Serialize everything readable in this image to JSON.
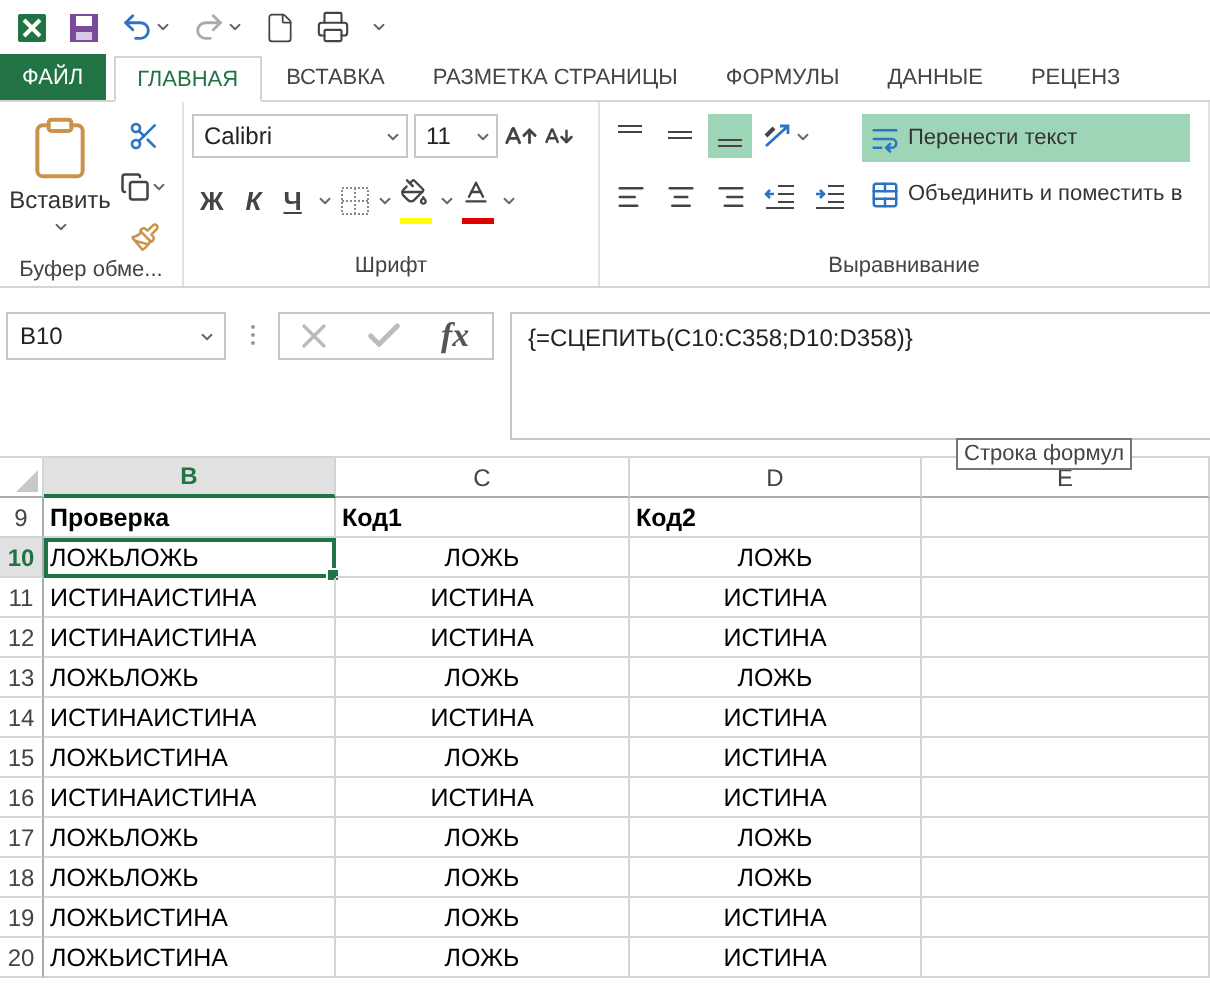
{
  "tabs": [
    {
      "label": "ФАЙЛ",
      "kind": "file",
      "selected": false
    },
    {
      "label": "ГЛАВНАЯ",
      "kind": "normal",
      "selected": true
    },
    {
      "label": "ВСТАВКА",
      "kind": "normal",
      "selected": false
    },
    {
      "label": "РАЗМЕТКА СТРАНИЦЫ",
      "kind": "normal",
      "selected": false
    },
    {
      "label": "ФОРМУЛЫ",
      "kind": "normal",
      "selected": false
    },
    {
      "label": "ДАННЫЕ",
      "kind": "normal",
      "selected": false
    },
    {
      "label": "РЕЦЕНЗ",
      "kind": "normal",
      "selected": false
    }
  ],
  "ribbon": {
    "clipboard": {
      "paste_label": "Вставить",
      "group_label": "Буфер обме..."
    },
    "font": {
      "font_name": "Calibri",
      "font_size": "11",
      "bold": "Ж",
      "italic": "К",
      "underline": "Ч",
      "group_label": "Шрифт"
    },
    "alignment": {
      "vertical": [
        {
          "selected": false
        },
        {
          "selected": false
        },
        {
          "selected": true
        }
      ],
      "wrap_text": {
        "label": "Перенести текст",
        "selected": true
      },
      "merge": {
        "label": "Объединить и поместить в"
      },
      "group_label": "Выравнивание"
    }
  },
  "formula_bar": {
    "name_box": "B10",
    "insert_function": "fx",
    "formula": "{=СЦЕПИТЬ(C10:C358;D10:D358)}",
    "tooltip": "Строка формул"
  },
  "sheet": {
    "columns": [
      {
        "label": "B",
        "selected": true
      },
      {
        "label": "C",
        "selected": false
      },
      {
        "label": "D",
        "selected": false
      },
      {
        "label": "E",
        "selected": false
      }
    ],
    "rows": [
      {
        "number": "9",
        "kind": "header",
        "selected": false,
        "cells": [
          "Проверка",
          "Код1",
          "Код2"
        ]
      },
      {
        "number": "10",
        "kind": "data",
        "selected": true,
        "cells": [
          "ЛОЖЬЛОЖЬ",
          "ЛОЖЬ",
          "ЛОЖЬ"
        ]
      },
      {
        "number": "11",
        "kind": "data",
        "selected": false,
        "cells": [
          "ИСТИНАИСТИНА",
          "ИСТИНА",
          "ИСТИНА"
        ]
      },
      {
        "number": "12",
        "kind": "data",
        "selected": false,
        "cells": [
          "ИСТИНАИСТИНА",
          "ИСТИНА",
          "ИСТИНА"
        ]
      },
      {
        "number": "13",
        "kind": "data",
        "selected": false,
        "cells": [
          "ЛОЖЬЛОЖЬ",
          "ЛОЖЬ",
          "ЛОЖЬ"
        ]
      },
      {
        "number": "14",
        "kind": "data",
        "selected": false,
        "cells": [
          "ИСТИНАИСТИНА",
          "ИСТИНА",
          "ИСТИНА"
        ]
      },
      {
        "number": "15",
        "kind": "data",
        "selected": false,
        "cells": [
          "ЛОЖЬИСТИНА",
          "ЛОЖЬ",
          "ИСТИНА"
        ]
      },
      {
        "number": "16",
        "kind": "data",
        "selected": false,
        "cells": [
          "ИСТИНАИСТИНА",
          "ИСТИНА",
          "ИСТИНА"
        ]
      },
      {
        "number": "17",
        "kind": "data",
        "selected": false,
        "cells": [
          "ЛОЖЬЛОЖЬ",
          "ЛОЖЬ",
          "ЛОЖЬ"
        ]
      },
      {
        "number": "18",
        "kind": "data",
        "selected": false,
        "cells": [
          "ЛОЖЬЛОЖЬ",
          "ЛОЖЬ",
          "ЛОЖЬ"
        ]
      },
      {
        "number": "19",
        "kind": "data",
        "selected": false,
        "cells": [
          "ЛОЖЬИСТИНА",
          "ЛОЖЬ",
          "ИСТИНА"
        ]
      },
      {
        "number": "20",
        "kind": "data",
        "selected": false,
        "cells": [
          "ЛОЖЬИСТИНА",
          "ЛОЖЬ",
          "ИСТИНА"
        ]
      }
    ]
  }
}
